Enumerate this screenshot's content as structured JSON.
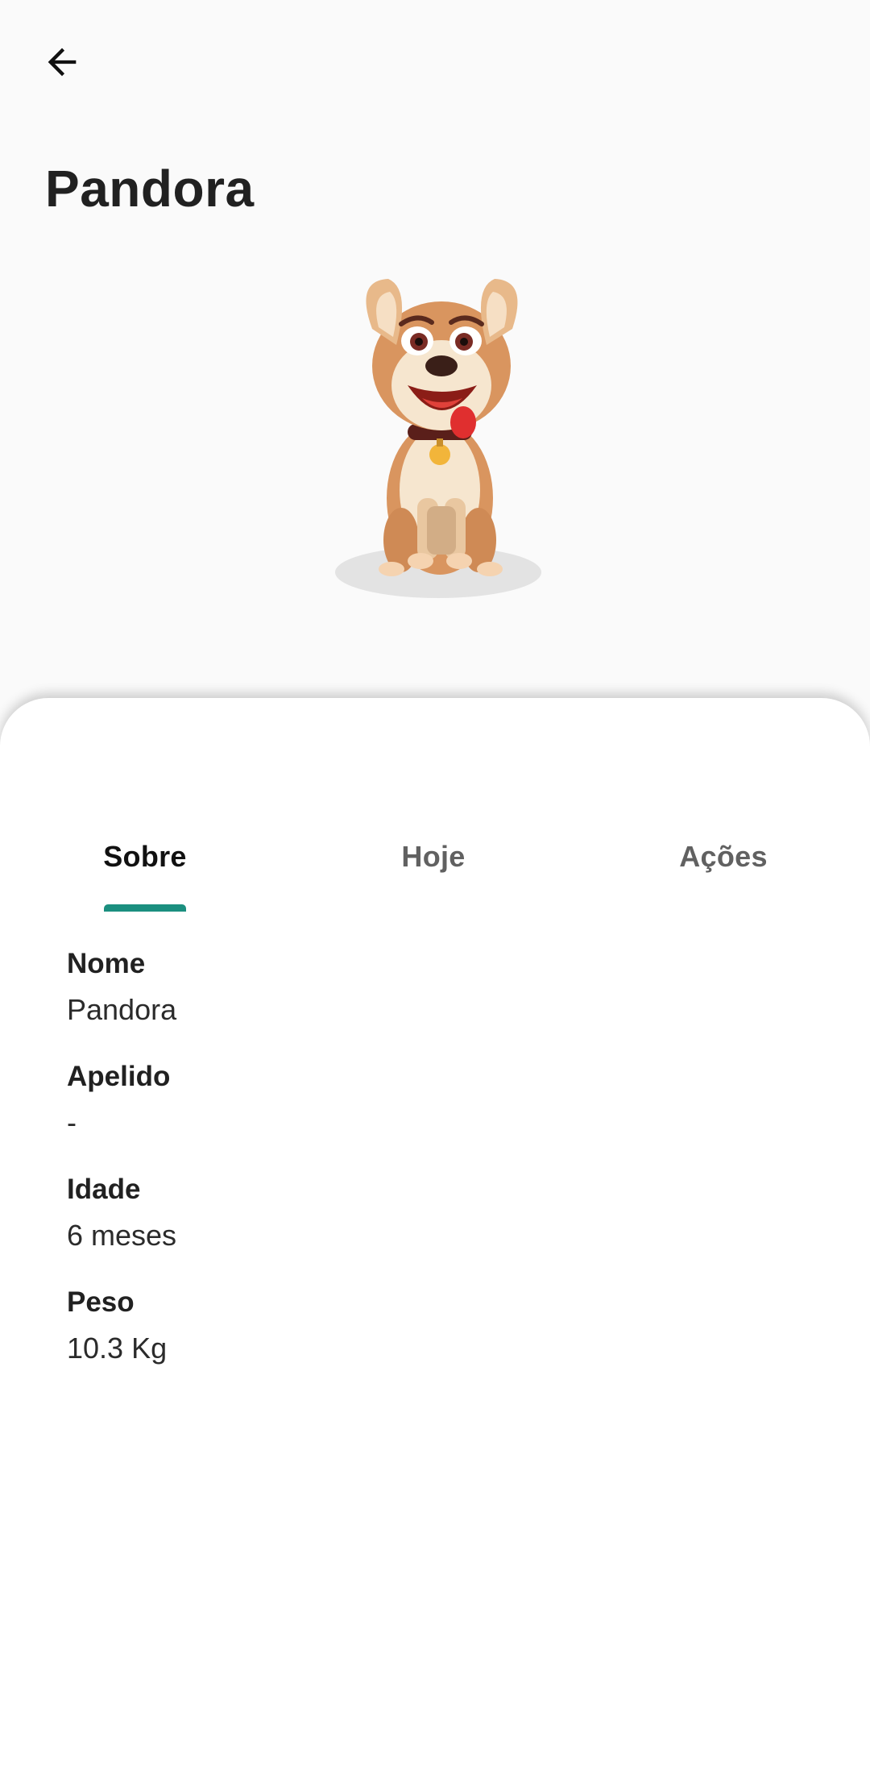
{
  "header": {
    "back_icon": "arrow-left-icon",
    "title": "Pandora"
  },
  "pet_image": {
    "icon": "cartoon-dog-illustration"
  },
  "tabs": [
    {
      "label": "Sobre",
      "active": true
    },
    {
      "label": "Hoje",
      "active": false
    },
    {
      "label": "Ações",
      "active": false
    }
  ],
  "fields": [
    {
      "label": "Nome",
      "value": "Pandora"
    },
    {
      "label": "Apelido",
      "value": "-"
    },
    {
      "label": "Idade",
      "value": "6 meses"
    },
    {
      "label": "Peso",
      "value": "10.3 Kg"
    }
  ],
  "colors": {
    "accent": "#1b8f7f",
    "background": "#fafafa",
    "sheet": "#ffffff"
  }
}
